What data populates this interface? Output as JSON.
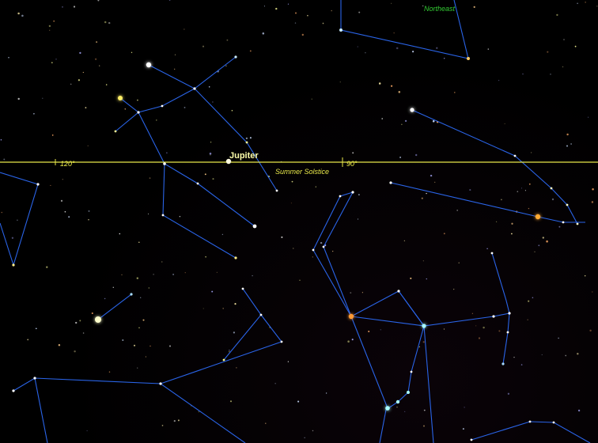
{
  "view": {
    "direction_label": "Northeast",
    "ecliptic_marks": [
      {
        "label": "120°"
      },
      {
        "label": "90°"
      }
    ],
    "ecliptic_point_label": "Summer Solstice",
    "planet_label": "Jupiter"
  },
  "colors": {
    "background": "#000000",
    "constellation_line": "#2a64e8",
    "ecliptic": "#e8e84a",
    "direction_label": "#33cc33",
    "planet_label": "#ffffaa"
  }
}
